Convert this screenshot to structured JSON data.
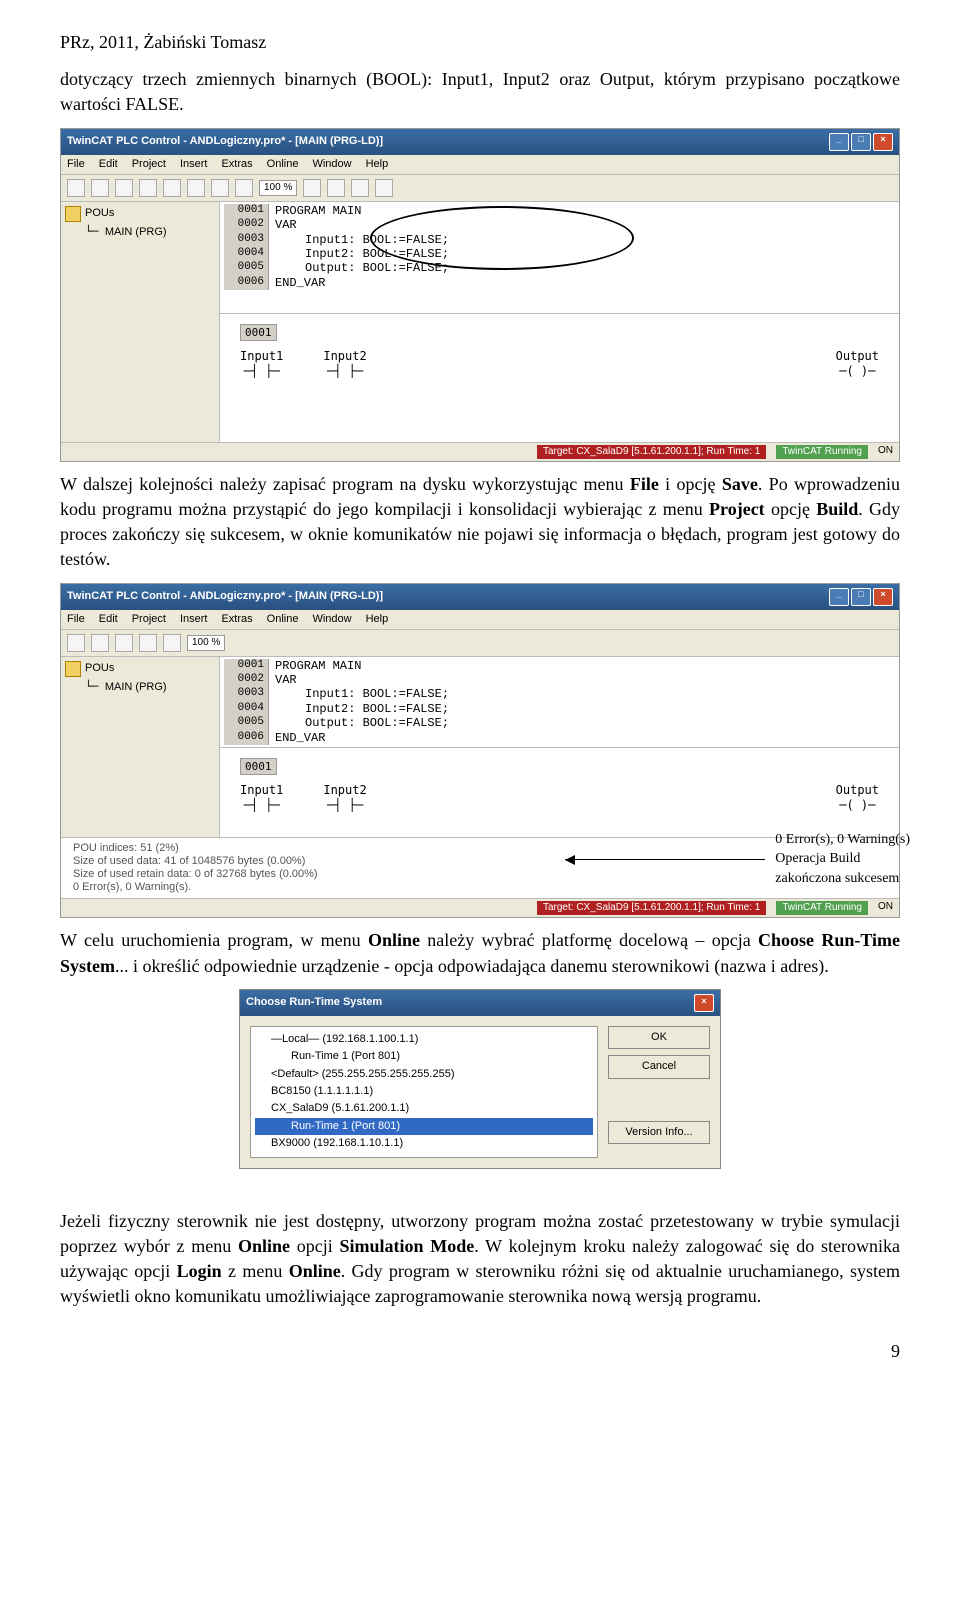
{
  "header": "PRz, 2011, Żabiński Tomasz",
  "para1": "dotyczący trzech zmiennych binarnych (BOOL): Input1, Input2 oraz Output, którym przypisano początkowe wartości FALSE.",
  "window1": {
    "title": "TwinCAT PLC Control - ANDLogiczny.pro* - [MAIN (PRG-LD)]",
    "menu": [
      "File",
      "Edit",
      "Project",
      "Insert",
      "Extras",
      "Online",
      "Window",
      "Help"
    ],
    "zoom": "100 %",
    "sidebar_label": "POUs",
    "tree_item": "MAIN (PRG)",
    "code": {
      "l1": "PROGRAM MAIN",
      "l2": "VAR",
      "l3a": "Input1: BOOL:=FALSE;",
      "l3b": "Input2: BOOL:=FALSE;",
      "l3c": "Output: BOOL:=FALSE;",
      "l4": "END_VAR"
    },
    "ladder": {
      "rail": "0001",
      "c1": "Input1",
      "c2": "Input2",
      "out": "Output"
    },
    "status_target": "Target: CX_SalaD9 [5.1.61.200.1.1]; Run Time: 1",
    "status_run": "TwinCAT Running",
    "status_on": "ON"
  },
  "para2_parts": {
    "a": "W dalszej kolejności należy zapisać program na dysku wykorzystując menu ",
    "b": "File",
    "c": " i opcję ",
    "d": "Save",
    "e": ". Po wprowadzeniu kodu programu można przystąpić do jego kompilacji i konsolidacji wybierając z menu ",
    "f": "Project",
    "g": " opcję ",
    "h": "Build",
    "i": ". Gdy proces zakończy się sukcesem, w oknie komunikatów nie pojawi się informacja o błędach, program jest gotowy do testów."
  },
  "window2": {
    "title": "TwinCAT PLC Control - ANDLogiczny.pro* - [MAIN (PRG-LD)]",
    "messages": {
      "m1": "POU indices: 51 (2%)",
      "m2": "Size of used data: 41 of 1048576 bytes (0.00%)",
      "m3": "Size of used retain data: 0 of 32768 bytes (0.00%)",
      "m4": "0 Error(s), 0 Warning(s)."
    }
  },
  "annotation": {
    "l1": "0 Error(s), 0 Warning(s)",
    "l2": "Operacja Build",
    "l3": "zakończona sukcesem"
  },
  "para3_parts": {
    "a": "W celu uruchomienia program, w menu ",
    "b": "Online",
    "c": " należy wybrać platformę docelową – opcja ",
    "d": "Choose Run-Time System",
    "e": "... i określić odpowiednie urządzenie - opcja odpowiadająca danemu sterownikowi (nazwa i adres)."
  },
  "dialog": {
    "title": "Choose Run-Time System",
    "items": {
      "i0": "—Local—   (192.168.1.100.1.1)",
      "i1": "Run-Time 1 (Port 801)",
      "i2": "<Default>   (255.255.255.255.255.255)",
      "i3": "BC8150   (1.1.1.1.1.1)",
      "i4": "CX_SalaD9   (5.1.61.200.1.1)",
      "i5": "Run-Time 1 (Port 801)",
      "i6": "BX9000   (192.168.1.10.1.1)"
    },
    "btn_ok": "OK",
    "btn_cancel": "Cancel",
    "btn_ver": "Version Info..."
  },
  "para4_parts": {
    "a": "Jeżeli fizyczny sterownik nie jest dostępny, utworzony program można zostać przetestowany w trybie symulacji poprzez wybór z menu ",
    "b": "Online",
    "c": " opcji ",
    "d": "Simulation Mode",
    "e": ". W kolejnym kroku należy zalogować się do sterownika używając opcji ",
    "f": "Login",
    "g": " z menu ",
    "h": "Online",
    "i": ". Gdy program w sterowniku różni się od aktualnie uruchamianego, system wyświetli okno komunikatu umożliwiające zaprogramowanie sterownika nową wersją programu."
  },
  "page_number": "9"
}
